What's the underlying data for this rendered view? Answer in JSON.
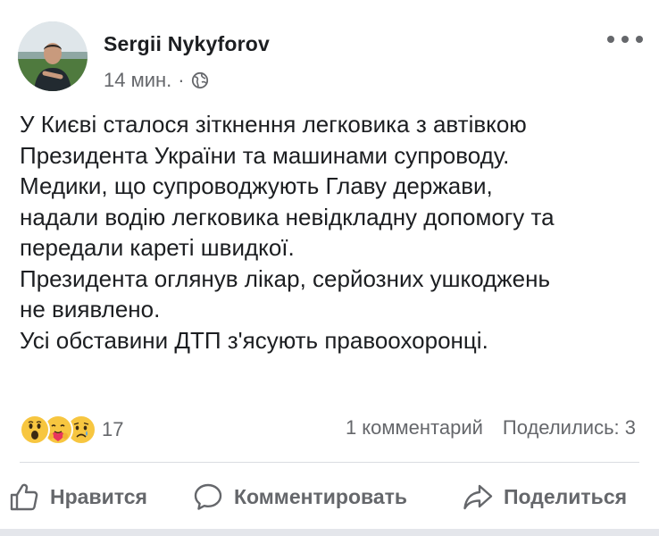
{
  "post": {
    "author_name": "Sergii Nykyforov",
    "time": "14 мин.",
    "separator": "·",
    "privacy_icon": "globe-icon",
    "more_icon": "more-horizontal-icon",
    "text_lines": [
      "У Києві сталося зіткнення легковика з автівкою",
      "Президента України та машинами супроводу.",
      "Медики, що супроводжують Главу держави,",
      "надали водію легковика невідкладну допомогу та",
      "передали кареті швидкої.",
      "Президента оглянув лікар, серйозних ушкоджень",
      "не виявлено.",
      "Усі обставини ДТП з'ясують правоохоронці."
    ]
  },
  "reactions": {
    "icons": [
      "wow-emoji",
      "care-emoji",
      "sad-emoji"
    ],
    "count": "17"
  },
  "counts": {
    "comments": "1 комментарий",
    "shares": "Поделились: 3"
  },
  "actions": {
    "like": {
      "label": "Нравится",
      "icon": "thumbs-up-icon"
    },
    "comment": {
      "label": "Комментировать",
      "icon": "comment-icon"
    },
    "share": {
      "label": "Поделиться",
      "icon": "share-icon"
    }
  },
  "colors": {
    "text": "#1c1e21",
    "secondary": "#65676b",
    "divider": "#dadde1",
    "emoji_yellow": "#f7c640"
  }
}
